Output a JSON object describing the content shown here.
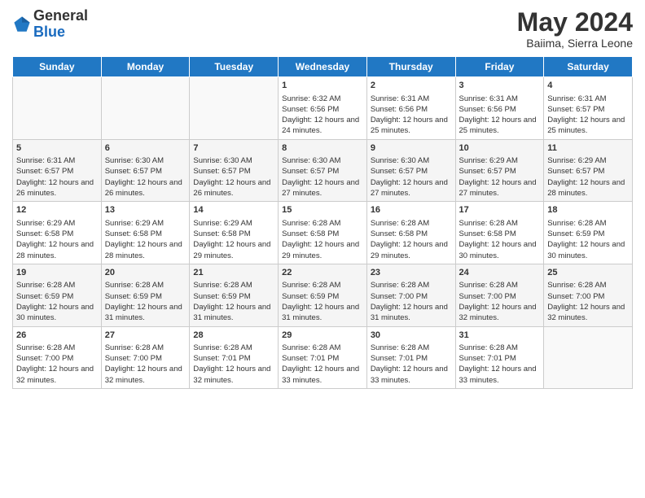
{
  "header": {
    "logo_general": "General",
    "logo_blue": "Blue",
    "month_title": "May 2024",
    "subtitle": "Baiima, Sierra Leone"
  },
  "days_of_week": [
    "Sunday",
    "Monday",
    "Tuesday",
    "Wednesday",
    "Thursday",
    "Friday",
    "Saturday"
  ],
  "weeks": [
    [
      {
        "day": "",
        "sunrise": "",
        "sunset": "",
        "daylight": ""
      },
      {
        "day": "",
        "sunrise": "",
        "sunset": "",
        "daylight": ""
      },
      {
        "day": "",
        "sunrise": "",
        "sunset": "",
        "daylight": ""
      },
      {
        "day": "1",
        "sunrise": "Sunrise: 6:32 AM",
        "sunset": "Sunset: 6:56 PM",
        "daylight": "Daylight: 12 hours and 24 minutes."
      },
      {
        "day": "2",
        "sunrise": "Sunrise: 6:31 AM",
        "sunset": "Sunset: 6:56 PM",
        "daylight": "Daylight: 12 hours and 25 minutes."
      },
      {
        "day": "3",
        "sunrise": "Sunrise: 6:31 AM",
        "sunset": "Sunset: 6:56 PM",
        "daylight": "Daylight: 12 hours and 25 minutes."
      },
      {
        "day": "4",
        "sunrise": "Sunrise: 6:31 AM",
        "sunset": "Sunset: 6:57 PM",
        "daylight": "Daylight: 12 hours and 25 minutes."
      }
    ],
    [
      {
        "day": "5",
        "sunrise": "Sunrise: 6:31 AM",
        "sunset": "Sunset: 6:57 PM",
        "daylight": "Daylight: 12 hours and 26 minutes."
      },
      {
        "day": "6",
        "sunrise": "Sunrise: 6:30 AM",
        "sunset": "Sunset: 6:57 PM",
        "daylight": "Daylight: 12 hours and 26 minutes."
      },
      {
        "day": "7",
        "sunrise": "Sunrise: 6:30 AM",
        "sunset": "Sunset: 6:57 PM",
        "daylight": "Daylight: 12 hours and 26 minutes."
      },
      {
        "day": "8",
        "sunrise": "Sunrise: 6:30 AM",
        "sunset": "Sunset: 6:57 PM",
        "daylight": "Daylight: 12 hours and 27 minutes."
      },
      {
        "day": "9",
        "sunrise": "Sunrise: 6:30 AM",
        "sunset": "Sunset: 6:57 PM",
        "daylight": "Daylight: 12 hours and 27 minutes."
      },
      {
        "day": "10",
        "sunrise": "Sunrise: 6:29 AM",
        "sunset": "Sunset: 6:57 PM",
        "daylight": "Daylight: 12 hours and 27 minutes."
      },
      {
        "day": "11",
        "sunrise": "Sunrise: 6:29 AM",
        "sunset": "Sunset: 6:57 PM",
        "daylight": "Daylight: 12 hours and 28 minutes."
      }
    ],
    [
      {
        "day": "12",
        "sunrise": "Sunrise: 6:29 AM",
        "sunset": "Sunset: 6:58 PM",
        "daylight": "Daylight: 12 hours and 28 minutes."
      },
      {
        "day": "13",
        "sunrise": "Sunrise: 6:29 AM",
        "sunset": "Sunset: 6:58 PM",
        "daylight": "Daylight: 12 hours and 28 minutes."
      },
      {
        "day": "14",
        "sunrise": "Sunrise: 6:29 AM",
        "sunset": "Sunset: 6:58 PM",
        "daylight": "Daylight: 12 hours and 29 minutes."
      },
      {
        "day": "15",
        "sunrise": "Sunrise: 6:28 AM",
        "sunset": "Sunset: 6:58 PM",
        "daylight": "Daylight: 12 hours and 29 minutes."
      },
      {
        "day": "16",
        "sunrise": "Sunrise: 6:28 AM",
        "sunset": "Sunset: 6:58 PM",
        "daylight": "Daylight: 12 hours and 29 minutes."
      },
      {
        "day": "17",
        "sunrise": "Sunrise: 6:28 AM",
        "sunset": "Sunset: 6:58 PM",
        "daylight": "Daylight: 12 hours and 30 minutes."
      },
      {
        "day": "18",
        "sunrise": "Sunrise: 6:28 AM",
        "sunset": "Sunset: 6:59 PM",
        "daylight": "Daylight: 12 hours and 30 minutes."
      }
    ],
    [
      {
        "day": "19",
        "sunrise": "Sunrise: 6:28 AM",
        "sunset": "Sunset: 6:59 PM",
        "daylight": "Daylight: 12 hours and 30 minutes."
      },
      {
        "day": "20",
        "sunrise": "Sunrise: 6:28 AM",
        "sunset": "Sunset: 6:59 PM",
        "daylight": "Daylight: 12 hours and 31 minutes."
      },
      {
        "day": "21",
        "sunrise": "Sunrise: 6:28 AM",
        "sunset": "Sunset: 6:59 PM",
        "daylight": "Daylight: 12 hours and 31 minutes."
      },
      {
        "day": "22",
        "sunrise": "Sunrise: 6:28 AM",
        "sunset": "Sunset: 6:59 PM",
        "daylight": "Daylight: 12 hours and 31 minutes."
      },
      {
        "day": "23",
        "sunrise": "Sunrise: 6:28 AM",
        "sunset": "Sunset: 7:00 PM",
        "daylight": "Daylight: 12 hours and 31 minutes."
      },
      {
        "day": "24",
        "sunrise": "Sunrise: 6:28 AM",
        "sunset": "Sunset: 7:00 PM",
        "daylight": "Daylight: 12 hours and 32 minutes."
      },
      {
        "day": "25",
        "sunrise": "Sunrise: 6:28 AM",
        "sunset": "Sunset: 7:00 PM",
        "daylight": "Daylight: 12 hours and 32 minutes."
      }
    ],
    [
      {
        "day": "26",
        "sunrise": "Sunrise: 6:28 AM",
        "sunset": "Sunset: 7:00 PM",
        "daylight": "Daylight: 12 hours and 32 minutes."
      },
      {
        "day": "27",
        "sunrise": "Sunrise: 6:28 AM",
        "sunset": "Sunset: 7:00 PM",
        "daylight": "Daylight: 12 hours and 32 minutes."
      },
      {
        "day": "28",
        "sunrise": "Sunrise: 6:28 AM",
        "sunset": "Sunset: 7:01 PM",
        "daylight": "Daylight: 12 hours and 32 minutes."
      },
      {
        "day": "29",
        "sunrise": "Sunrise: 6:28 AM",
        "sunset": "Sunset: 7:01 PM",
        "daylight": "Daylight: 12 hours and 33 minutes."
      },
      {
        "day": "30",
        "sunrise": "Sunrise: 6:28 AM",
        "sunset": "Sunset: 7:01 PM",
        "daylight": "Daylight: 12 hours and 33 minutes."
      },
      {
        "day": "31",
        "sunrise": "Sunrise: 6:28 AM",
        "sunset": "Sunset: 7:01 PM",
        "daylight": "Daylight: 12 hours and 33 minutes."
      },
      {
        "day": "",
        "sunrise": "",
        "sunset": "",
        "daylight": ""
      }
    ]
  ]
}
